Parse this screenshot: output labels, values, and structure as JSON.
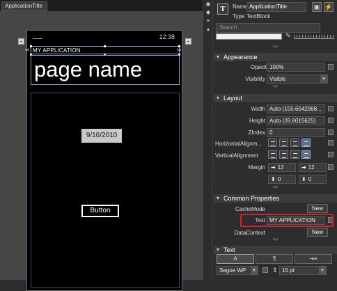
{
  "document_tab": {
    "label": "ApplicationTitle"
  },
  "phone": {
    "status_time": "12:38",
    "app_title": "MY APPLICATION",
    "page_name": "page name",
    "date_text": "9/16/2010",
    "button_label": "Button"
  },
  "properties": {
    "name_label": "Name",
    "name_value": "ApplicationTitle",
    "type_label": "Type",
    "type_value": "TextBlock",
    "search_placeholder": "Search",
    "appearance": {
      "header": "Appearance",
      "opacity_label": "Opacity",
      "opacity_value": "100%",
      "visibility_label": "Visibility",
      "visibility_value": "Visible"
    },
    "layout": {
      "header": "Layout",
      "width_label": "Width",
      "width_value": "Auto (155.6542968...",
      "height_label": "Height",
      "height_value": "Auto (26.6015625)",
      "zindex_label": "ZIndex",
      "zindex_value": "0",
      "halign_label": "HorizontalAlignm...",
      "valign_label": "VerticalAlignment",
      "margin_label": "Margin",
      "margin_left": "12",
      "margin_right": "12",
      "margin_top": "0",
      "margin_bottom": "0"
    },
    "common": {
      "header": "Common Properties",
      "cachemode_label": "CacheMode",
      "new_label": "New",
      "text_label": "Text",
      "text_value": "MY APPLICATION",
      "datacontext_label": "DataContext",
      "new_label_2": "New"
    },
    "text_section": {
      "header": "Text",
      "font_family": "Segoe WP",
      "font_size": "15 pt"
    }
  },
  "colors": {
    "highlight": "#d0202a",
    "selection": "#8ea3c8",
    "panel_bg": "#2d2d30"
  }
}
